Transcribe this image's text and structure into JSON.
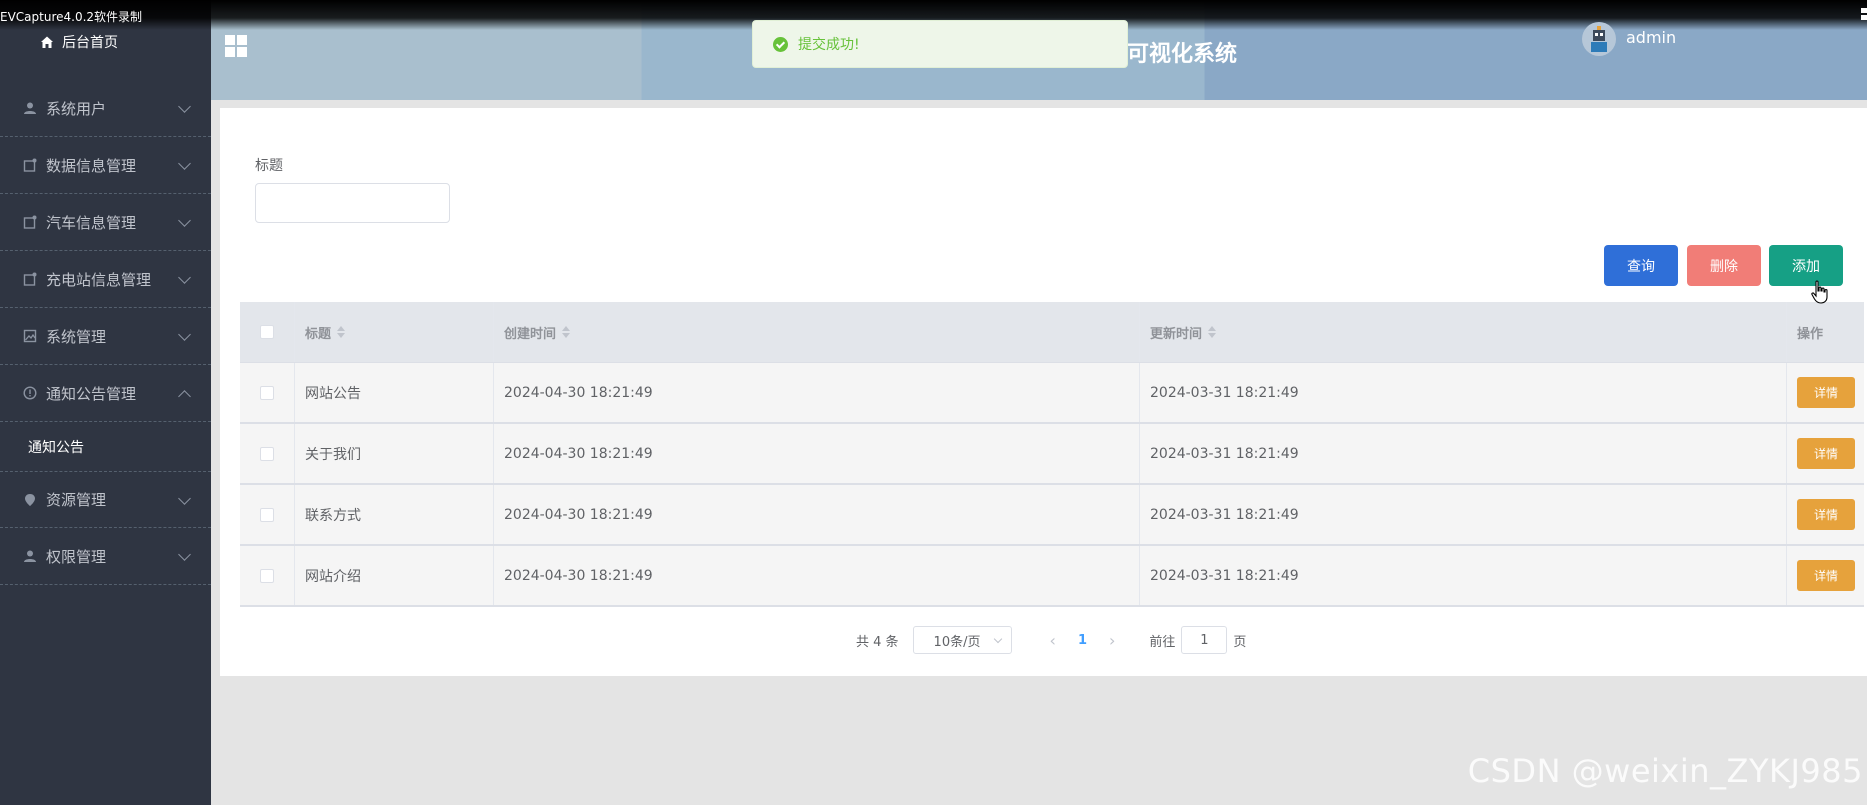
{
  "capture": {
    "title": "EVCapture4.0.2软件录制"
  },
  "sidebar": {
    "home": "后台首页",
    "items": [
      {
        "label": "系统用户",
        "icon": "user-icon"
      },
      {
        "label": "数据信息管理",
        "icon": "doc-icon"
      },
      {
        "label": "汽车信息管理",
        "icon": "doc-icon"
      },
      {
        "label": "充电站信息管理",
        "icon": "doc-icon"
      },
      {
        "label": "系统管理",
        "icon": "picture-icon"
      },
      {
        "label": "通知公告管理",
        "icon": "info-icon",
        "expanded": true
      },
      {
        "label": "资源管理",
        "icon": "location-icon"
      },
      {
        "label": "权限管理",
        "icon": "user-icon"
      }
    ],
    "sub_active": "通知公告"
  },
  "header": {
    "title": "可视化系统",
    "user": "admin"
  },
  "toast": {
    "message": "提交成功!"
  },
  "filter": {
    "label": "标题",
    "value": ""
  },
  "buttons": {
    "query": "查询",
    "delete": "删除",
    "add": "添加"
  },
  "table": {
    "columns": [
      "标题",
      "创建时间",
      "更新时间",
      "操作"
    ],
    "rows": [
      {
        "title": "网站公告",
        "created": "2024-04-30 18:21:49",
        "updated": "2024-03-31 18:21:49",
        "action": "详情"
      },
      {
        "title": "关于我们",
        "created": "2024-04-30 18:21:49",
        "updated": "2024-03-31 18:21:49",
        "action": "详情"
      },
      {
        "title": "联系方式",
        "created": "2024-04-30 18:21:49",
        "updated": "2024-03-31 18:21:49",
        "action": "详情"
      },
      {
        "title": "网站介绍",
        "created": "2024-04-30 18:21:49",
        "updated": "2024-03-31 18:21:49",
        "action": "详情"
      }
    ]
  },
  "pagination": {
    "total": "共 4 条",
    "page_size": "10条/页",
    "current": "1",
    "goto_prefix": "前往",
    "goto_value": "1",
    "goto_suffix": "页"
  },
  "watermark": "CSDN @weixin_ZYKJ985",
  "colors": {
    "sidebar": "#2f3542",
    "query": "#2f6fd8",
    "delete": "#f17d77",
    "add": "#16a085",
    "detail": "#e6a23c",
    "success": "#67c23a"
  }
}
